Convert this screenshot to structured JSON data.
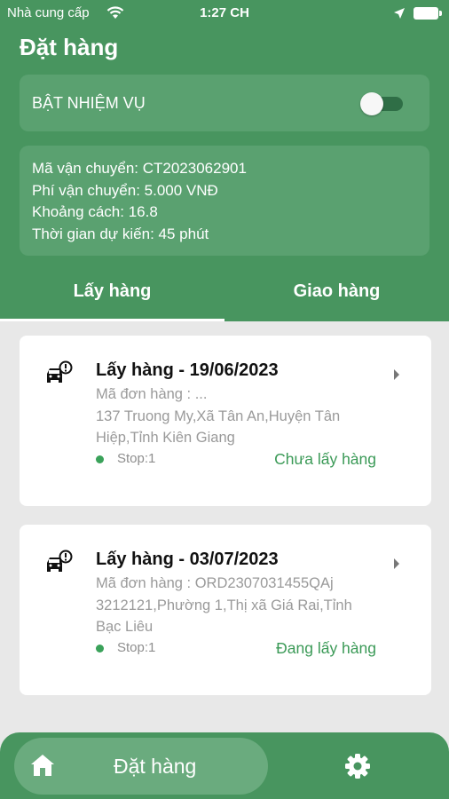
{
  "status_bar": {
    "carrier": "Nhà cung cấp",
    "time": "1:27 CH"
  },
  "header": {
    "title": "Đặt hàng"
  },
  "mission": {
    "label": "BẬT NHIỆM VỤ",
    "enabled": false
  },
  "info": {
    "lines": [
      "Mã vận chuyển: CT2023062901",
      "Phí vận chuyển: 5.000 VNĐ",
      "Khoảng cách: 16.8",
      "Thời gian dự kiến: 45 phút"
    ]
  },
  "tabs": [
    {
      "label": "Lấy hàng",
      "active": true
    },
    {
      "label": "Giao hàng",
      "active": false
    }
  ],
  "orders": [
    {
      "title": "Lấy hàng - 19/06/2023",
      "desc_lines": [
        "Mã đơn hàng : ...",
        "137 Truong My,Xã Tân An,Huyện Tân",
        "Hiệp,Tỉnh Kiên Giang"
      ],
      "stop": "Stop:1",
      "status": "Chưa lấy hàng"
    },
    {
      "title": "Lấy hàng - 03/07/2023",
      "desc_lines": [
        "Mã đơn hàng : ORD2307031455QAj",
        "3212121,Phường 1,Thị xã Giá Rai,Tỉnh",
        "Bạc Liêu"
      ],
      "stop": "Stop:1",
      "status": "Đang lấy hàng"
    }
  ],
  "bottom_nav": {
    "active_label": "Đặt hàng",
    "icons": [
      "home-icon",
      "gear-icon"
    ]
  },
  "colors": {
    "primary": "#48955f",
    "card": "#5aa170",
    "status_green": "#3b9a57"
  }
}
